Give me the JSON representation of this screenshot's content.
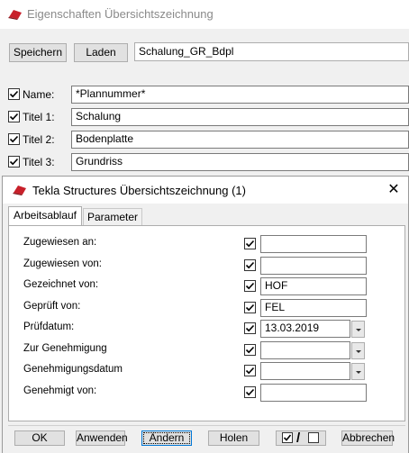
{
  "back_window": {
    "title": "Eigenschaften Übersichtszeichnung",
    "save_label": "Speichern",
    "load_label": "Laden",
    "file_value": "Schalung_GR_Bdpl",
    "rows": [
      {
        "label": "Name:",
        "value": "*Plannummer*",
        "checked": true
      },
      {
        "label": "Titel 1:",
        "value": "Schalung",
        "checked": true
      },
      {
        "label": "Titel 2:",
        "value": "Bodenplatte",
        "checked": true
      },
      {
        "label": "Titel 3:",
        "value": "Grundriss",
        "checked": true
      }
    ]
  },
  "dialog": {
    "title": "Tekla Structures  Übersichtszeichnung (1)",
    "close_glyph": "✕",
    "tabs": [
      "Arbeitsablauf",
      "Parameter"
    ],
    "active_tab": "Arbeitsablauf",
    "rows": [
      {
        "label": "Zugewiesen an:",
        "value": "",
        "checked": true,
        "dropdown": false
      },
      {
        "label": "Zugewiesen von:",
        "value": "",
        "checked": true,
        "dropdown": false
      },
      {
        "label": "Gezeichnet von:",
        "value": "HOF",
        "checked": true,
        "dropdown": false
      },
      {
        "label": "Geprüft von:",
        "value": "FEL",
        "checked": true,
        "dropdown": false
      },
      {
        "label": "Prüfdatum:",
        "value": "13.03.2019",
        "checked": true,
        "dropdown": true
      },
      {
        "label": "Zur Genehmigung",
        "value": "",
        "checked": true,
        "dropdown": true
      },
      {
        "label": "Genehmigungsdatum",
        "value": "",
        "checked": true,
        "dropdown": true
      },
      {
        "label": "Genehmigt von:",
        "value": "",
        "checked": true,
        "dropdown": false
      }
    ],
    "footer": {
      "ok": "OK",
      "apply": "Anwenden",
      "modify": "Ändern",
      "get": "Holen",
      "toggle_slash": "/",
      "cancel": "Abbrechen"
    }
  },
  "colors": {
    "logo_red": "#c8202a",
    "focus_blue": "#0078d7"
  },
  "icons": {
    "app_logo": "tekla-logo-icon",
    "checkbox": "checkmark-icon",
    "close": "close-icon"
  }
}
